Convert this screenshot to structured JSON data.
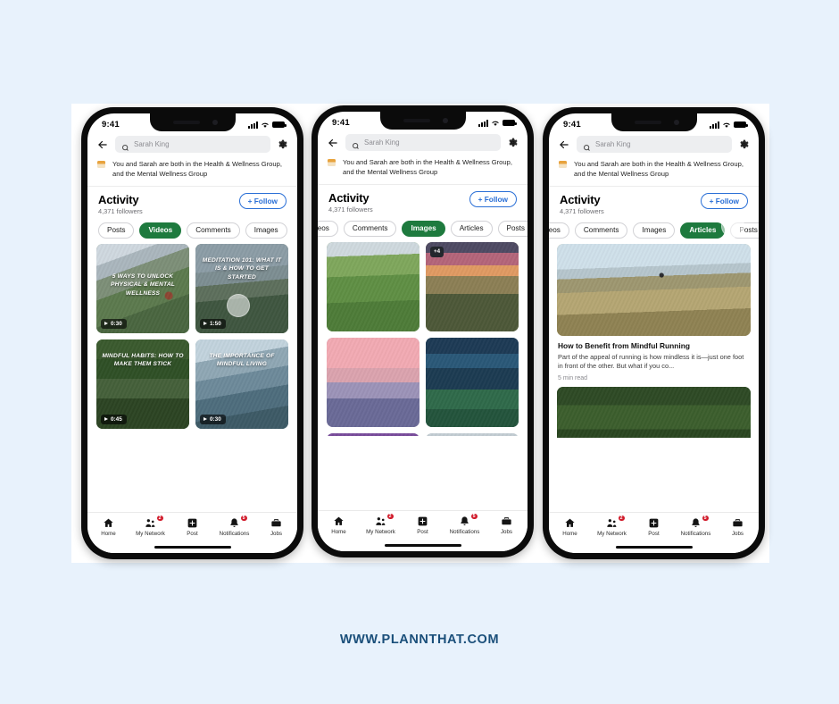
{
  "footer": {
    "url": "WWW.PLANNTHAT.COM"
  },
  "status_bar": {
    "time": "9:41",
    "icons": [
      "signal-icon",
      "wifi-icon",
      "battery-icon"
    ]
  },
  "search": {
    "value": "Sarah King",
    "placeholder": "Search",
    "back_icon": "back-arrow-icon",
    "settings_icon": "gear-icon"
  },
  "notice": {
    "text": "You and Sarah are both in the Health & Wellness Group, and the Mental Wellness Group"
  },
  "activity": {
    "title": "Activity",
    "followers": "4,371 followers",
    "follow_label": "+ Follow"
  },
  "tabbar": {
    "items": [
      {
        "label": "Home",
        "icon": "home-icon",
        "badge": ""
      },
      {
        "label": "My Network",
        "icon": "network-icon",
        "badge": "2"
      },
      {
        "label": "Post",
        "icon": "post-plus-icon",
        "badge": ""
      },
      {
        "label": "Notifications",
        "icon": "bell-icon",
        "badge": "5"
      },
      {
        "label": "Jobs",
        "icon": "briefcase-icon",
        "badge": ""
      }
    ]
  },
  "phones": [
    {
      "id": "phone-videos",
      "pills": [
        {
          "label": "Posts",
          "active": false
        },
        {
          "label": "Videos",
          "active": true
        },
        {
          "label": "Comments",
          "active": false
        },
        {
          "label": "Images",
          "active": false
        }
      ],
      "videos": [
        {
          "title": "5 WAYS TO UNLOCK PHYSICAL & MENTAL WELLNESS",
          "duration": "0:30",
          "photo": "ph-mtn-trail",
          "title_pos": "mid"
        },
        {
          "title": "MEDITATION 101: WHAT IT IS & HOW TO GET STARTED",
          "duration": "1:50",
          "photo": "ph-cliff",
          "title_pos": "top"
        },
        {
          "title": "MINDFUL HABITS: HOW TO MAKE THEM STICK",
          "duration": "0:45",
          "photo": "ph-forest-hiker",
          "title_pos": "top"
        },
        {
          "title": "THE IMPORTANCE OF MINDFUL LIVING",
          "duration": "0:30",
          "photo": "ph-fjord",
          "title_pos": "top"
        }
      ]
    },
    {
      "id": "phone-images",
      "pills": [
        {
          "label": "Videos",
          "active": false
        },
        {
          "label": "Comments",
          "active": false
        },
        {
          "label": "Images",
          "active": true
        },
        {
          "label": "Articles",
          "active": false
        },
        {
          "label": "Posts",
          "active": false
        }
      ],
      "images": [
        {
          "photo": "ph-green-valley",
          "badge": ""
        },
        {
          "photo": "ph-sunset-hills",
          "badge": "+4"
        },
        {
          "photo": "ph-pink-mtn",
          "badge": ""
        },
        {
          "photo": "ph-night-mtn",
          "badge": ""
        },
        {
          "photo": "ph-purple-lake",
          "badge": ""
        },
        {
          "photo": "ph-misty-lake",
          "badge": ""
        }
      ]
    },
    {
      "id": "phone-articles",
      "pills": [
        {
          "label": "Videos",
          "active": false
        },
        {
          "label": "Comments",
          "active": false
        },
        {
          "label": "Images",
          "active": false
        },
        {
          "label": "Articles",
          "active": true
        },
        {
          "label": "Posts",
          "active": false
        }
      ],
      "articles": [
        {
          "title": "How to Benefit from Mindful Running",
          "snippet": "Part of the appeal of running is how mindless it is—just one foot in front of the other. But what if you co...",
          "meta": "5 min read",
          "photo": "ph-runner-hill"
        },
        {
          "title": "",
          "snippet": "",
          "meta": "",
          "photo": "ph-bridge-forest"
        }
      ]
    }
  ],
  "colors": {
    "background": "#e8f2fc",
    "pill_active": "#1e7a3e",
    "follow_blue": "#2a6fd6",
    "badge_red": "#d11a2a",
    "footer_blue": "#1a4f7a"
  }
}
